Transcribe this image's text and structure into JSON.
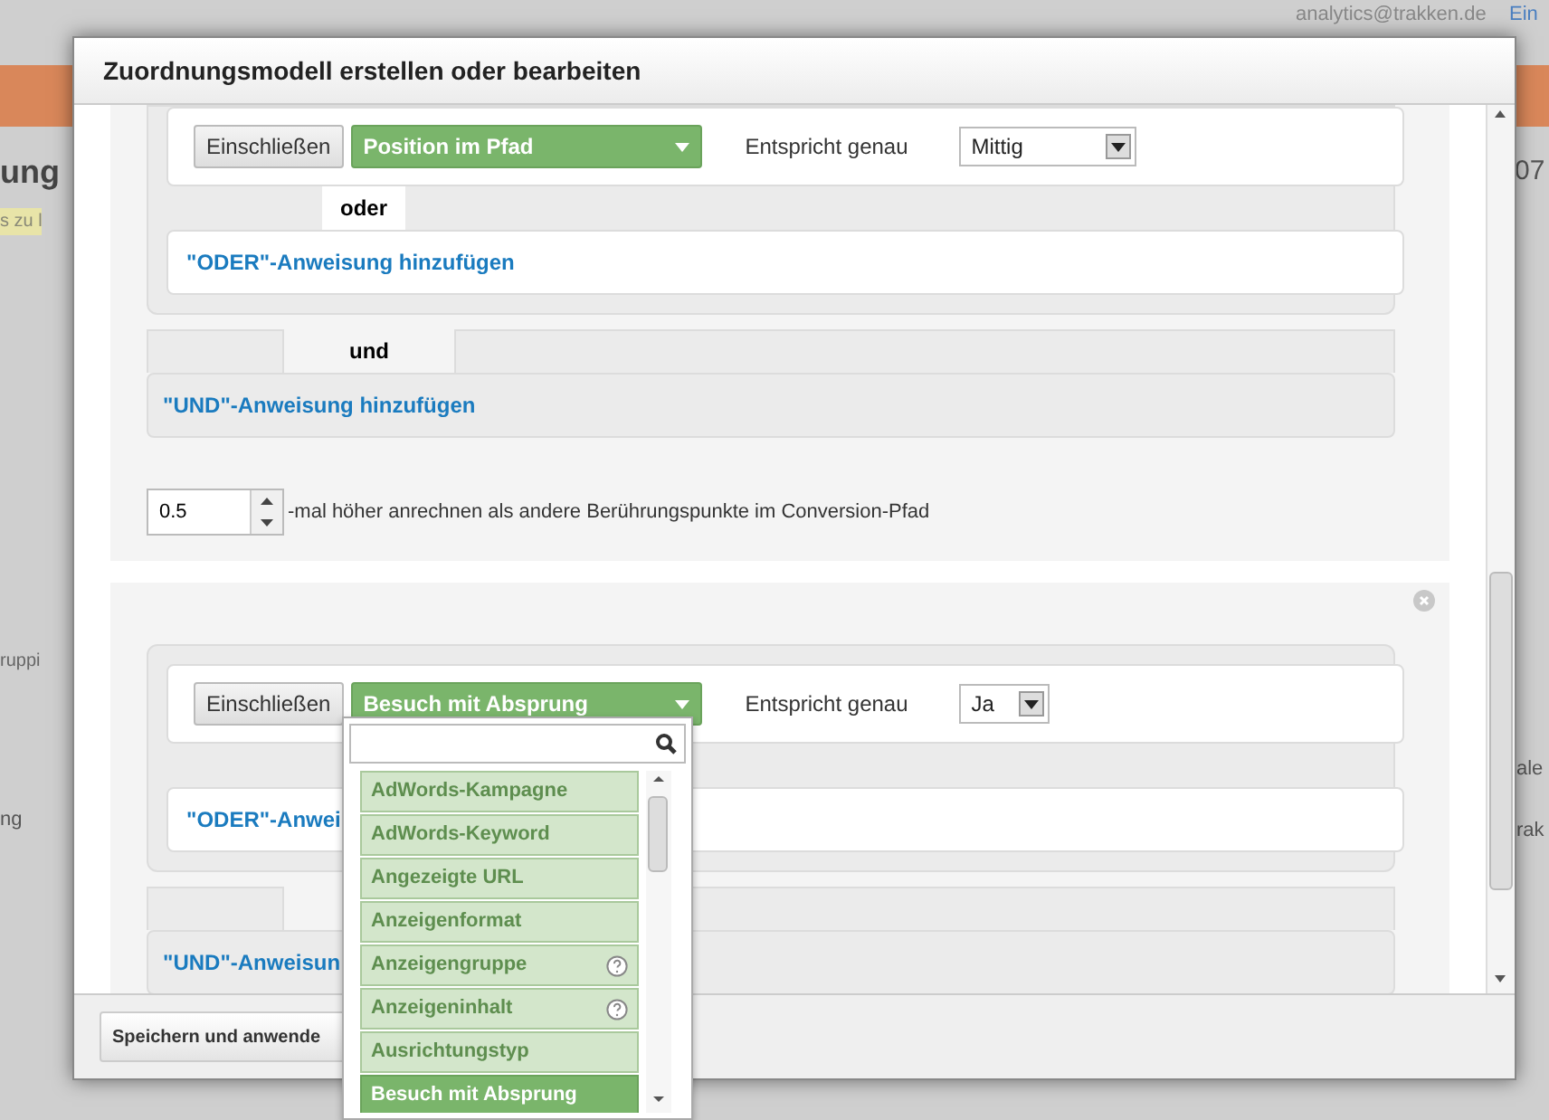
{
  "background": {
    "account": "analytics@trakken.de",
    "link": "Ein",
    "left_fragments": [
      "ung",
      "s zu l",
      "ruppi",
      "ng"
    ],
    "right_fragments": [
      "07",
      "ale",
      "rak"
    ]
  },
  "dialog": {
    "title": "Zuordnungsmodell erstellen oder bearbeiten",
    "rules": [
      {
        "removable": false,
        "include_button": "Einschließen",
        "dimension": "Position im Pfad",
        "match_label": "Entspricht genau",
        "match_value": "Mittig",
        "or_label": "oder",
        "or_link": "\"ODER\"-Anweisung hinzufügen",
        "and_label": "und",
        "and_link": "\"UND\"-Anweisung hinzufügen",
        "weight": "0.5",
        "weight_text": "-mal höher anrechnen als andere Berührungspunkte im Conversion-Pfad"
      },
      {
        "removable": true,
        "include_button": "Einschließen",
        "dimension": "Besuch mit Absprung",
        "match_label": "Entspricht genau",
        "match_value": "Ja",
        "or_link": "\"ODER\"-Anwei",
        "and_link": "\"UND\"-Anweisun"
      }
    ],
    "dropdown": {
      "items": [
        {
          "label": "AdWords-Kampagne",
          "help": false,
          "selected": false
        },
        {
          "label": "AdWords-Keyword",
          "help": false,
          "selected": false
        },
        {
          "label": "Angezeigte URL",
          "help": false,
          "selected": false
        },
        {
          "label": "Anzeigenformat",
          "help": false,
          "selected": false
        },
        {
          "label": "Anzeigengruppe",
          "help": true,
          "selected": false
        },
        {
          "label": "Anzeigeninhalt",
          "help": true,
          "selected": false
        },
        {
          "label": "Ausrichtungstyp",
          "help": false,
          "selected": false
        },
        {
          "label": "Besuch mit Absprung",
          "help": false,
          "selected": true
        }
      ]
    },
    "save_button": "Speichern und anwende"
  }
}
